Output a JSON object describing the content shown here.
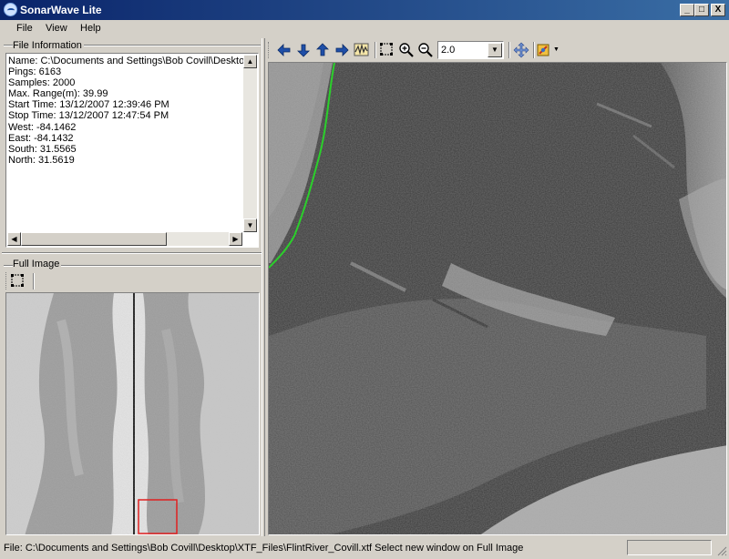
{
  "window": {
    "title": "SonarWave Lite",
    "controls": {
      "minimize": "_",
      "maximize": "□",
      "close": "X"
    }
  },
  "menu": [
    "File",
    "View",
    "Help"
  ],
  "file_info": {
    "label": "File Information",
    "lines": [
      "Name: C:\\Documents and Settings\\Bob Covill\\Desktop\\XT",
      "Pings: 6163",
      "Samples: 2000",
      "Max. Range(m): 39.99",
      "Start Time: 13/12/2007 12:39:46 PM",
      "Stop Time: 13/12/2007 12:47:54 PM",
      "West: -84.1462",
      "East: -84.1432",
      "South: 31.5565",
      "North: 31.5619"
    ]
  },
  "full_image": {
    "label": "Full Image"
  },
  "toolbar": {
    "icons": [
      "arrow-left-icon",
      "arrow-down-icon",
      "arrow-up-icon",
      "arrow-right-icon",
      "waveform-icon",
      "zoom-rect-icon",
      "zoom-in-icon",
      "zoom-out-icon"
    ],
    "zoom_value": "2.0",
    "colors": {
      "arrow": "#1f4fa8",
      "selection": "#e02020",
      "edge_line": "#2bd02b"
    }
  },
  "status": {
    "text": "File: C:\\Documents and Settings\\Bob Covill\\Desktop\\XTF_Files\\FlintRiver_Covill.xtf  Select new window on Full Image"
  }
}
